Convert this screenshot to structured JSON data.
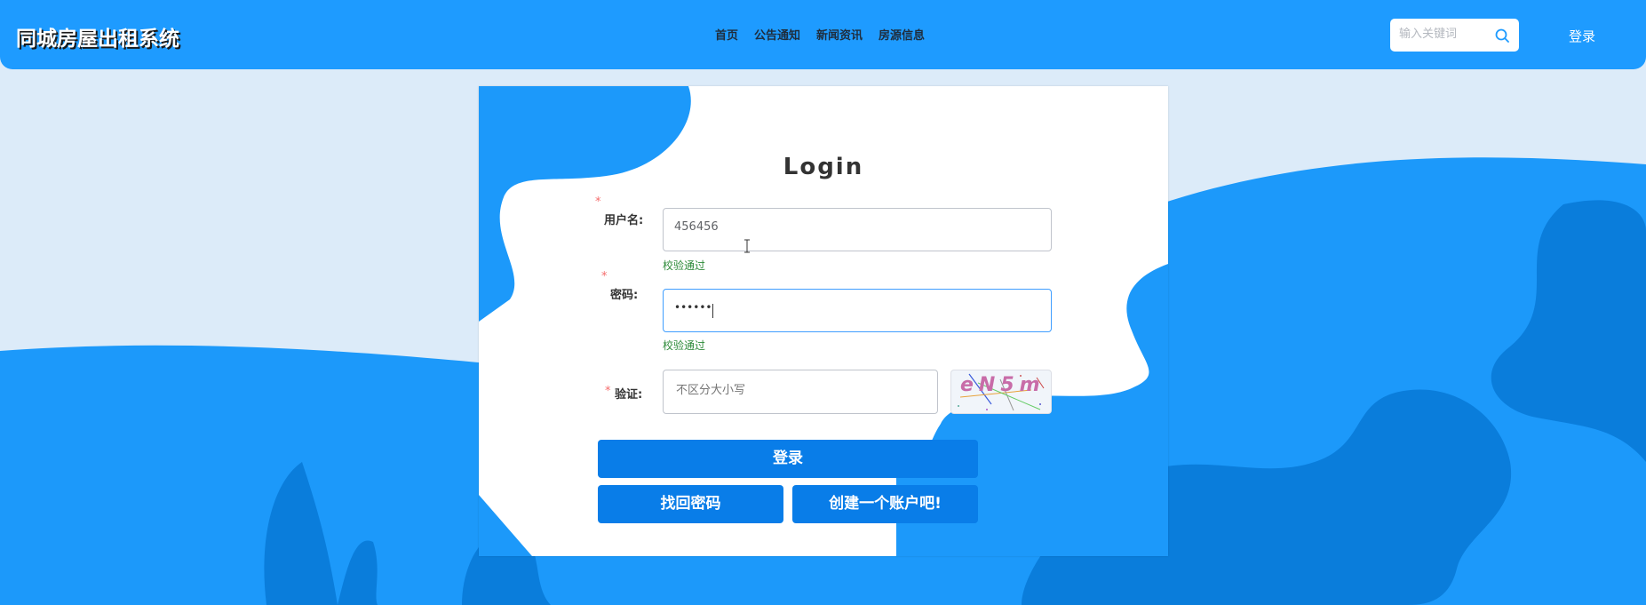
{
  "header": {
    "site_title": "同城房屋出租系统",
    "nav": [
      "首页",
      "公告通知",
      "新闻资讯",
      "房源信息"
    ],
    "search_placeholder": "输入关键词",
    "login_label": "登录"
  },
  "form": {
    "title": "Login",
    "username": {
      "required_mark": "*",
      "label": "用户名:",
      "value": "456456",
      "status": "校验通过"
    },
    "password": {
      "required_mark": "*",
      "label": "密码:",
      "value": "••••••",
      "status": "校验通过"
    },
    "captcha": {
      "required_mark": "*",
      "label": "验证:",
      "placeholder": "不区分大小写",
      "code": "eN5m"
    },
    "login_button": "登录",
    "forgot_button": "找回密码",
    "register_button": "创建一个账户吧!"
  },
  "colors": {
    "header_bg": "#1e9bff",
    "button_bg": "#097de8",
    "page_bg": "#dcebf9",
    "success_text": "#2e8b3a",
    "required_mark": "#f56c6c"
  }
}
